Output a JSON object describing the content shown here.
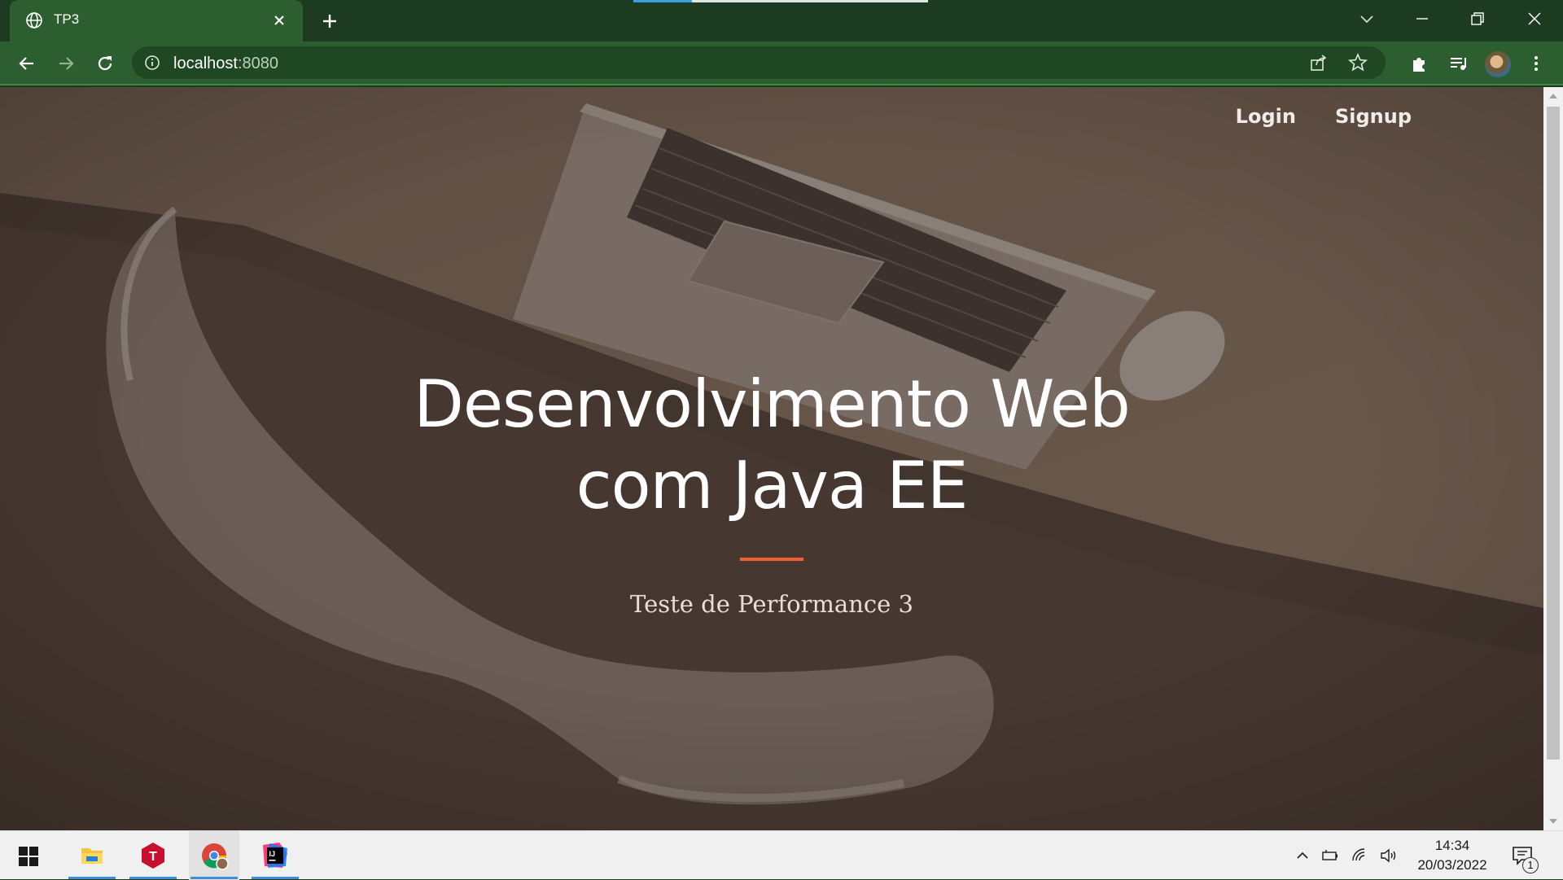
{
  "browser": {
    "tab": {
      "title": "TP3"
    },
    "address": {
      "host": "localhost",
      "port": ":8080"
    },
    "icons": [
      "globe-icon",
      "close-icon",
      "plus-icon",
      "chevron-down-icon",
      "minimize-icon",
      "restore-icon",
      "close-icon",
      "back-icon",
      "forward-icon",
      "reload-icon",
      "info-icon",
      "share-icon",
      "star-icon",
      "extensions-icon",
      "reading-list-icon",
      "menu-icon"
    ],
    "colors": {
      "frame": "#1d3b20",
      "toolbar": "#2c5e2f",
      "omnibox": "#1e4722"
    }
  },
  "nav": {
    "login": "Login",
    "signup": "Signup"
  },
  "hero": {
    "title_line1": "Desenvolvimento Web",
    "title_line2": "com Java EE",
    "subtitle": "Teste de Performance 3",
    "accent": "#f05f35"
  },
  "taskbar": {
    "apps": [
      "file-explorer",
      "t-app",
      "chrome",
      "intellij-idea"
    ],
    "time": "14:34",
    "date": "20/03/2022",
    "notifications": "1"
  }
}
